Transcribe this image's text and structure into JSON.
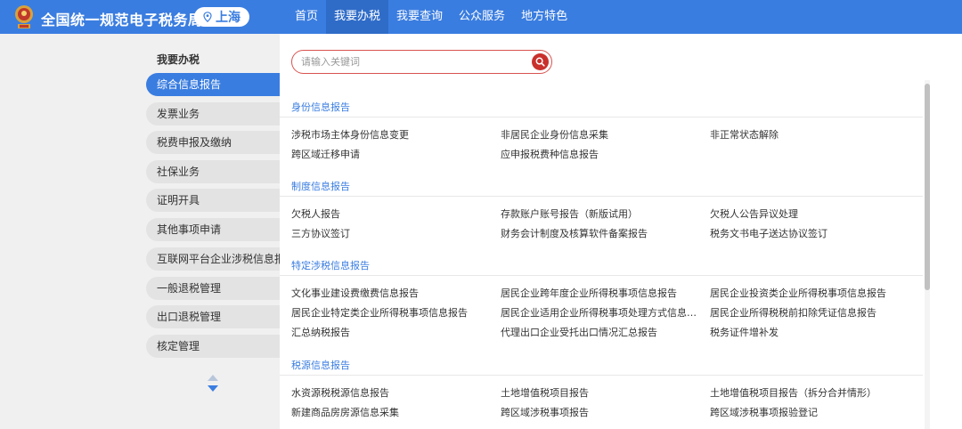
{
  "header": {
    "site_title": "全国统一规范电子税务局",
    "city": "上海",
    "nav": [
      "首页",
      "我要办税",
      "我要查询",
      "公众服务",
      "地方特色"
    ]
  },
  "sidebar": {
    "heading": "我要办税",
    "items": [
      "综合信息报告",
      "发票业务",
      "税费申报及缴纳",
      "社保业务",
      "证明开具",
      "其他事项申请",
      "互联网平台企业涉税信息报送",
      "一般退税管理",
      "出口退税管理",
      "核定管理"
    ]
  },
  "search": {
    "placeholder": "请输入关键词"
  },
  "sections": [
    {
      "title": "身份信息报告",
      "links": [
        "涉税市场主体身份信息变更",
        "非居民企业身份信息采集",
        "非正常状态解除",
        "跨区域迁移申请",
        "应申报税费种信息报告"
      ]
    },
    {
      "title": "制度信息报告",
      "links": [
        "欠税人报告",
        "存款账户账号报告（新版试用）",
        "欠税人公告异议处理",
        "三方协议签订",
        "财务会计制度及核算软件备案报告",
        "税务文书电子送达协议签订"
      ]
    },
    {
      "title": "特定涉税信息报告",
      "links": [
        "文化事业建设费缴费信息报告",
        "居民企业跨年度企业所得税事项信息报告",
        "居民企业投资类企业所得税事项信息报告",
        "居民企业特定类企业所得税事项信息报告",
        "居民企业适用企业所得税事项处理方式信息报告",
        "居民企业所得税税前扣除凭证信息报告",
        "汇总纳税报告",
        "代理出口企业受托出口情况汇总报告",
        "税务证件增补发"
      ]
    },
    {
      "title": "税源信息报告",
      "links": [
        "水资源税税源信息报告",
        "土地增值税项目报告",
        "土地增值税项目报告（拆分合并情形）",
        "新建商品房房源信息采集",
        "跨区域涉税事项报告",
        "跨区域涉税事项报验登记"
      ]
    }
  ],
  "colors": {
    "brand": "#3a7de0",
    "search_border": "#d9534f",
    "search_button": "#c9302c"
  }
}
